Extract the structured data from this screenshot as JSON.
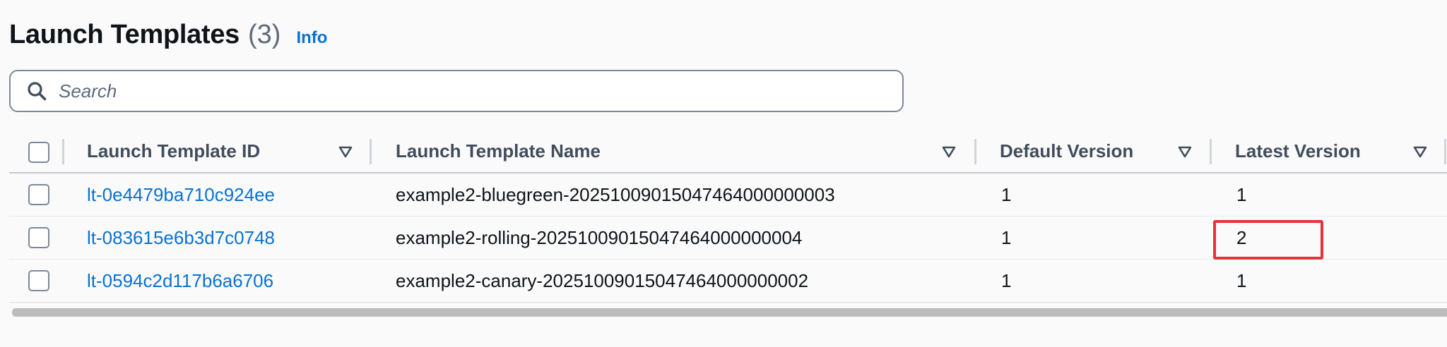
{
  "header": {
    "title": "Launch Templates",
    "count": "(3)",
    "info_label": "Info"
  },
  "search": {
    "placeholder": "Search",
    "value": ""
  },
  "table": {
    "columns": [
      {
        "label": "Launch Template ID",
        "sort_icon": "caret-down-icon"
      },
      {
        "label": "Launch Template Name",
        "sort_icon": "caret-down-icon"
      },
      {
        "label": "Default Version",
        "sort_icon": "caret-down-icon"
      },
      {
        "label": "Latest Version",
        "sort_icon": "caret-down-icon"
      }
    ],
    "rows": [
      {
        "id": "lt-0e4479ba710c924ee",
        "name": "example2-bluegreen-20251009015047464000000003",
        "default_version": "1",
        "latest_version": "1"
      },
      {
        "id": "lt-083615e6b3d7c0748",
        "name": "example2-rolling-20251009015047464000000004",
        "default_version": "1",
        "latest_version": "2"
      },
      {
        "id": "lt-0594c2d117b6a6706",
        "name": "example2-canary-20251009015047464000000002",
        "default_version": "1",
        "latest_version": "1"
      }
    ]
  },
  "colors": {
    "link": "#0972d3",
    "highlight": "#e8313b",
    "header_text": "#414d5c",
    "border": "#7d8998"
  }
}
